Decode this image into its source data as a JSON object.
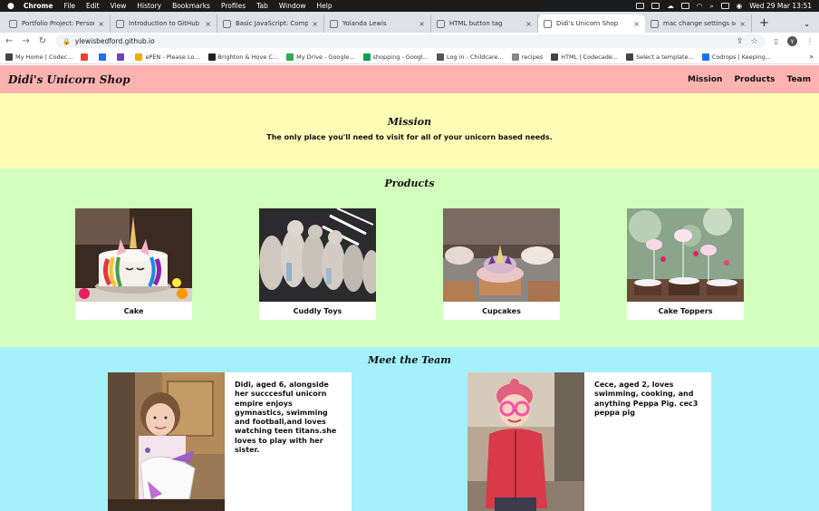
{
  "os_menu": {
    "app": "Chrome",
    "items": [
      "File",
      "Edit",
      "View",
      "History",
      "Bookmarks",
      "Profiles",
      "Tab",
      "Window",
      "Help"
    ],
    "clock": "Wed 29 Mar  13:51"
  },
  "browser": {
    "tabs": [
      {
        "title": "Portfolio Project: Personal H",
        "active": false
      },
      {
        "title": "Introduction to GitHub | Cod",
        "active": false
      },
      {
        "title": "Basic JavaScript: Compound",
        "active": false
      },
      {
        "title": "Yolanda Lewis",
        "active": false
      },
      {
        "title": "HTML button tag",
        "active": false
      },
      {
        "title": "Didi's Unicorn Shop",
        "active": true
      },
      {
        "title": "mac change settings scree",
        "active": false
      }
    ],
    "new_tab_glyph": "+",
    "url": "ylewisbedford.github.io",
    "avatar_letter": "Y",
    "bookmarks": [
      {
        "label": "My Home | Codec...",
        "color": "#444444"
      },
      {
        "label": "",
        "color": "#ea4335"
      },
      {
        "label": "",
        "color": "#1a73e8"
      },
      {
        "label": "",
        "color": "#6f42c1"
      },
      {
        "label": "ePEN - Please Lo...",
        "color": "#f2a900"
      },
      {
        "label": "Brighton & Hove C...",
        "color": "#222222"
      },
      {
        "label": "My Drive - Google...",
        "color": "#34a853"
      },
      {
        "label": "shopping - Googl...",
        "color": "#0f9d58"
      },
      {
        "label": "Log in - Childcare...",
        "color": "#555555"
      },
      {
        "label": "recipes",
        "color": "#888888"
      },
      {
        "label": "HTML | Codecade...",
        "color": "#444444"
      },
      {
        "label": "Select a template...",
        "color": "#444444"
      },
      {
        "label": "Codrops | Keeping...",
        "color": "#1a73e8"
      }
    ],
    "more_bookmarks_glyph": "»"
  },
  "site": {
    "logo": "Didi's Unicorn Shop",
    "nav": [
      "Mission",
      "Products",
      "Team"
    ],
    "mission": {
      "title": "Mission",
      "text": "The only place you'll need to visit for all of your unicorn based needs."
    },
    "products": {
      "title": "Products",
      "items": [
        {
          "label": "Cake"
        },
        {
          "label": "Cuddly Toys"
        },
        {
          "label": "Cupcakes"
        },
        {
          "label": "Cake Toppers"
        }
      ]
    },
    "team": {
      "title": "Meet the Team",
      "members": [
        {
          "bio": "Didi, aged 6, alongside her succcesful unicorn empire enjoys gymnastics, swimming and football,and loves watching teen titans.she loves to play with her sister."
        },
        {
          "bio": "Cece, aged 2, loves swimming, cooking, and anything Peppa Pig. cec3 peppa pig"
        }
      ]
    }
  },
  "colors": {
    "header": "#ffb3b1",
    "mission_bg": "#fffdb5",
    "products_bg": "#d2ffbd",
    "team_bg": "#a4f1fd"
  }
}
